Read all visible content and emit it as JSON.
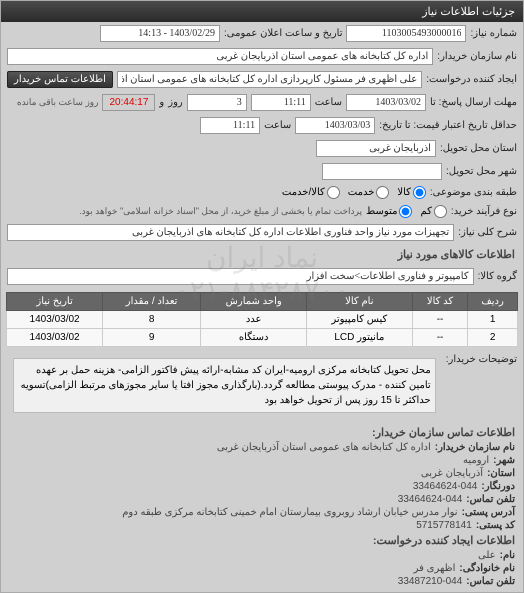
{
  "header": {
    "title": "جزئیات اطلاعات نیاز"
  },
  "form": {
    "number_label": "شماره نیاز:",
    "number_value": "1103005493000016",
    "announce_label": "تاریخ و ساعت اعلان عمومی:",
    "announce_value": "1403/02/29 - 14:13",
    "buyer_label": "نام سازمان خریدار:",
    "buyer_value": "اداره کل کتابخانه های عمومی استان آذربایجان غربی",
    "requester_label": "ایجاد کننده درخواست:",
    "requester_value": "علی اظهری فر مسئول کارپردازی اداره کل کتابخانه های عمومی استان آذربایجا",
    "contact_btn": "اطلاعات تماس خریدار",
    "deadline_send_label": "مهلت ارسال پاسخ: تا",
    "deadline_send_date": "1403/03/02",
    "time_label": "ساعت",
    "deadline_send_time": "11:11",
    "days_label": "روز",
    "days_value": "3",
    "and_label": "و",
    "countdown": "20:44:17",
    "remaining_label": "روز ساعت باقی مانده",
    "validity_label": "حداقل تاریخ اعتبار قیمت: تا تاریخ:",
    "validity_date": "1403/03/03",
    "validity_time": "11:11",
    "delivery_province_label": "استان محل تحویل:",
    "delivery_province": "آذربایجان غربی",
    "delivery_city_label": "شهر محل تحویل:",
    "delivery_city": "",
    "budget_type_label": "طبقه بندی موضوعی:",
    "radio_goods": "کالا",
    "radio_service": "خدمت",
    "radio_goods_service": "کالا/خدمت",
    "process_label": "نوع فرآیند خرید:",
    "radio_low": "کم",
    "radio_medium": "متوسط",
    "process_note": "پرداخت تمام یا بخشی از مبلغ خرید، از محل \"اسناد خزانه اسلامی\" خواهد بود.",
    "need_title_label": "شرح کلی نیاز:",
    "need_title_value": "تجهیزات مورد نیاز واحد فناوری اطلاعات اداره کل کتابخانه های آذربایجان غربی"
  },
  "goods": {
    "section_title": "اطلاعات کالاهای مورد نیاز",
    "group_label": "گروه کالا:",
    "group_value": "کامپیوتر و فناوری اطلاعات>سخت افزار",
    "columns": [
      "ردیف",
      "کد کالا",
      "نام کالا",
      "واحد شمارش",
      "تعداد / مقدار",
      "تاریخ نیاز"
    ],
    "rows": [
      {
        "idx": "1",
        "code": "--",
        "name": "کیس کامپیوتر",
        "unit": "عدد",
        "qty": "8",
        "date": "1403/03/02"
      },
      {
        "idx": "2",
        "code": "--",
        "name": "مانیتور LCD",
        "unit": "دستگاه",
        "qty": "9",
        "date": "1403/03/02"
      }
    ],
    "desc_label": "توضیحات خریدار:",
    "desc_value": "محل تحویل کتابخانه مرکزی ارومیه-ایران کد مشابه-ارائه پیش فاکتور الزامی- هزینه حمل بر عهده تامین کننده - مدرک پیوستی مطالعه گردد.(بارگذاری مجوز افتا یا سایر مجوزهای مرتبط الزامی)تسویه حداکثر تا 15 روز پس از تحویل خواهد بود"
  },
  "contact": {
    "section_title": "اطلاعات تماس سازمان خریدار:",
    "org_label": "نام سازمان خریدار:",
    "org_value": "اداره کل کتابخانه های عمومی استان آذربایجان غربی",
    "city_label": "شهر:",
    "city_value": "ارومیه",
    "province_label": "استان:",
    "province_value": "آذربایجان غربی",
    "fax_label": "دورنگار:",
    "fax_value": "33464624-044",
    "phone_label": "تلفن تماس:",
    "phone_value": "33464624-044",
    "address_label": "آدرس پستی:",
    "address_value": "نوار مدرس خیابان ارشاد روبروی بیمارستان امام خمینی کتابخانه مرکزی طبقه دوم",
    "postal_label": "کد پستی:",
    "postal_value": "5715778141",
    "requester_section_title": "اطلاعات ایجاد کننده درخواست:",
    "fname_label": "نام:",
    "fname_value": "علی",
    "lname_label": "نام خانوادگی:",
    "lname_value": "اظهری فر",
    "rphone_label": "تلفن تماس:",
    "rphone_value": "33487210-044"
  },
  "watermark": {
    "text1": "نماد ایران",
    "text2": "۰۲۱-۸۸۴۲۸۷۰۰"
  }
}
